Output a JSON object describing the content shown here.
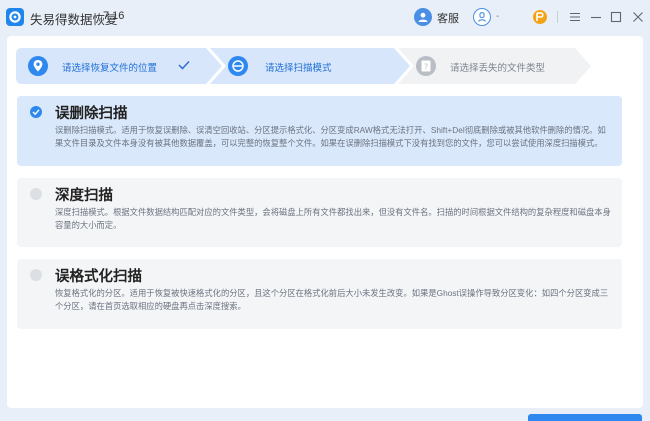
{
  "app": {
    "title": "失易得数据恢复",
    "version": "7.16"
  },
  "header": {
    "service_label": "客服",
    "user_label": "-",
    "icons": [
      "app-logo-icon",
      "headset-icon",
      "user-icon",
      "premium-icon",
      "menu-icon",
      "minimize-icon",
      "maximize-icon",
      "close-icon"
    ]
  },
  "steps": [
    {
      "label": "请选择恢复文件的位置",
      "state": "done",
      "icon": "location-pin-icon"
    },
    {
      "label": "请选择扫描模式",
      "state": "active",
      "icon": "scan-icon"
    },
    {
      "label": "请选择丢失的文件类型",
      "state": "pending",
      "icon": "question-icon"
    }
  ],
  "modes": [
    {
      "title": "误删除扫描",
      "selected": true,
      "description": "误删除扫描模式。适用于恢复误删除、误清空回收站、分区提示格式化、分区变成RAW格式无法打开、Shift+Del彻底删除或被其他软件删除的情况。如果文件目录及文件本身没有被其他数据覆盖，可以完整的恢复整个文件。如果在误删除扫描模式下没有找到您的文件，您可以尝试使用深度扫描模式。"
    },
    {
      "title": "深度扫描",
      "selected": false,
      "description": "深度扫描模式。根据文件数据结构匹配对应的文件类型，会将磁盘上所有文件都找出来，但没有文件名。扫描的时间根据文件结构的复杂程度和磁盘本身容量的大小而定。"
    },
    {
      "title": "误格式化扫描",
      "selected": false,
      "description": "恢复格式化的分区。适用于恢复被快速格式化的分区，且这个分区在格式化前后大小未发生改变。如果是Ghost误操作导致分区变化：如四个分区变成三个分区，请在首页选取相应的硬盘再点击深度搜索。"
    }
  ],
  "colors": {
    "accent": "#2f88f0",
    "selected_bg": "#d9e8fb",
    "card_bg": "#f4f5f7",
    "window_bg": "#e8eff8"
  }
}
